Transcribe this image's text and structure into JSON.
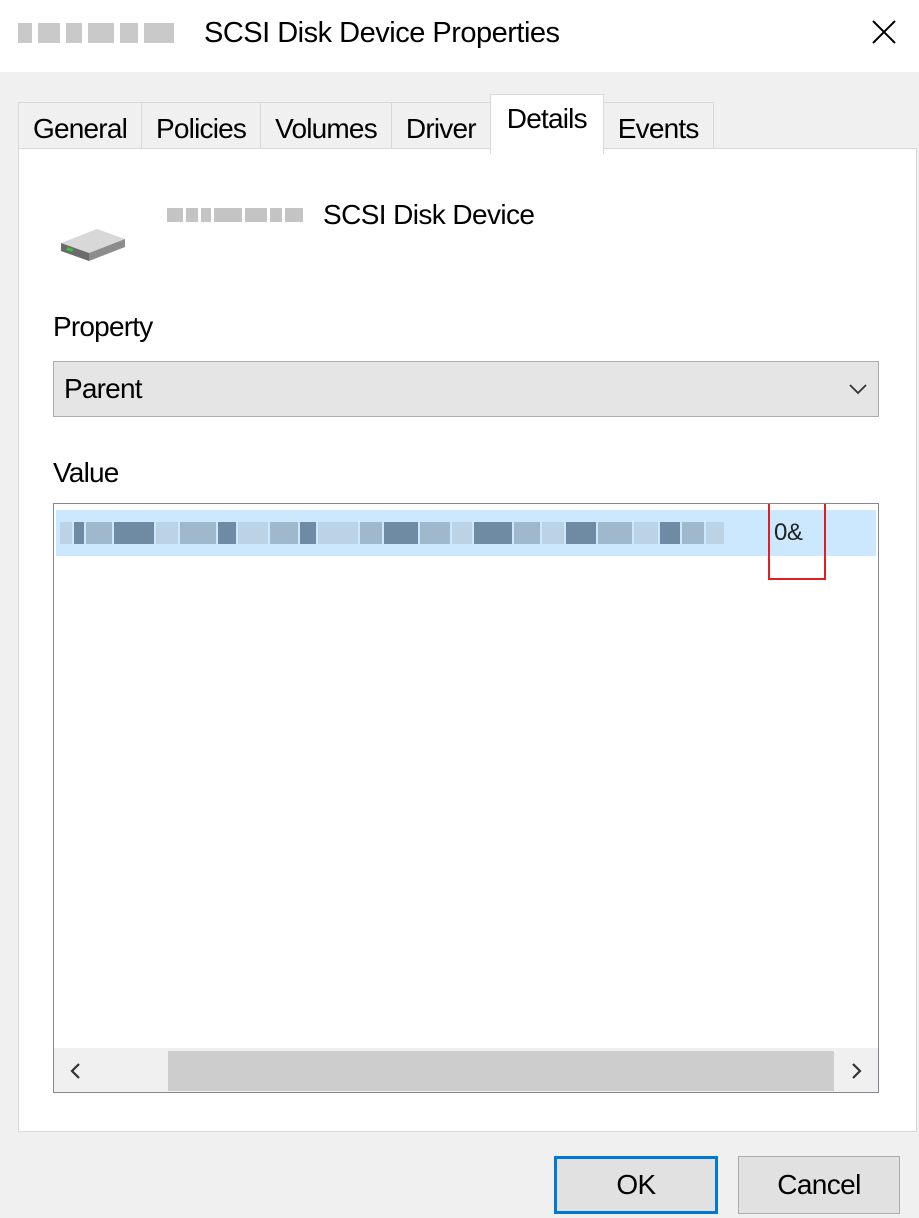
{
  "window": {
    "title": "SCSI Disk Device Properties",
    "close_glyph": "close-icon"
  },
  "tabs": [
    {
      "label": "General",
      "active": false
    },
    {
      "label": "Policies",
      "active": false
    },
    {
      "label": "Volumes",
      "active": false
    },
    {
      "label": "Driver",
      "active": false
    },
    {
      "label": "Details",
      "active": true
    },
    {
      "label": "Events",
      "active": false
    }
  ],
  "device": {
    "name_suffix": "SCSI Disk Device",
    "icon": "disk-drive-icon"
  },
  "property": {
    "label": "Property",
    "selected": "Parent"
  },
  "value": {
    "label": "Value",
    "visible_tail": "0&"
  },
  "buttons": {
    "ok": "OK",
    "cancel": "Cancel"
  },
  "colors": {
    "selection": "#cce8ff",
    "default_button_border": "#0078d7",
    "annotation": "#e02020"
  }
}
